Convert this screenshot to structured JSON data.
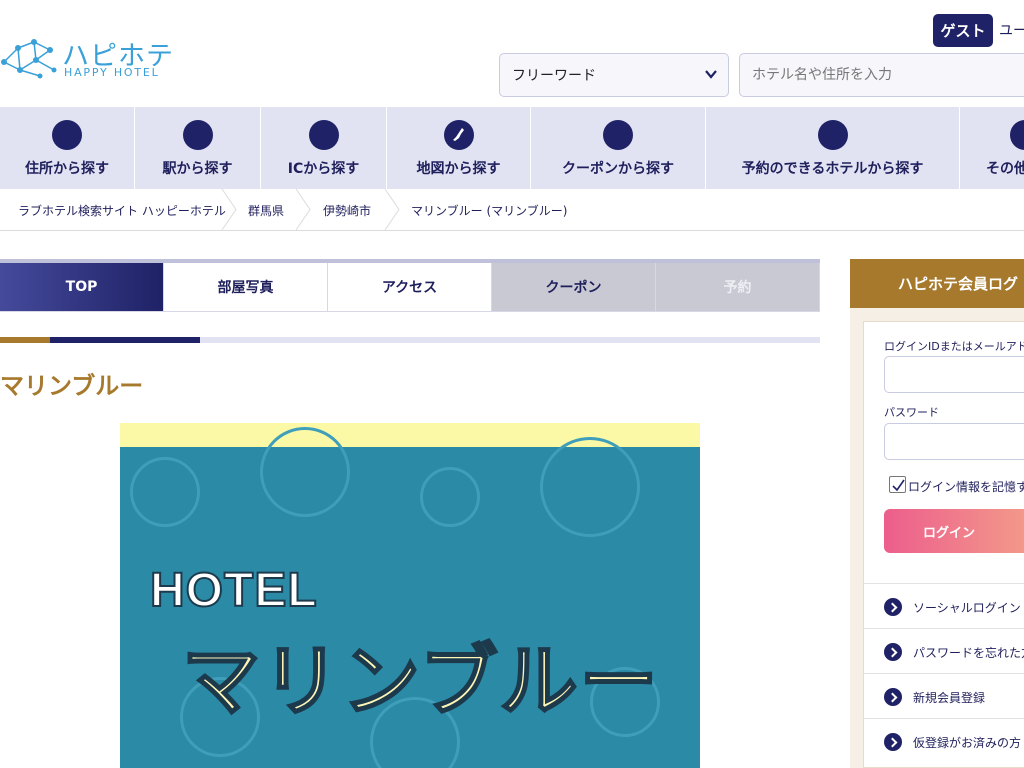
{
  "header": {
    "logo_jp": "ハピホテ",
    "logo_en": "HAPPY HOTEL",
    "guest_badge": "ゲスト",
    "user_text": "ユー",
    "search_mode": "フリーワード",
    "search_placeholder": "ホテル名や住所を入力"
  },
  "nav": {
    "items": [
      {
        "label": "住所から探す"
      },
      {
        "label": "駅から探す"
      },
      {
        "label": "ICから探す"
      },
      {
        "label": "地図から探す"
      },
      {
        "label": "クーポンから探す"
      },
      {
        "label": "予約のできるホテルから探す"
      },
      {
        "label": "その他"
      }
    ]
  },
  "breadcrumb": {
    "items": [
      "ラブホテル検索サイト ハッピーホテル",
      "群馬県",
      "伊勢崎市",
      "マリンブルー (マリンブルー)"
    ]
  },
  "tabs": {
    "items": [
      "TOP",
      "部屋写真",
      "アクセス",
      "クーポン",
      "予約"
    ]
  },
  "hotel": {
    "name": "マリンブルー",
    "image_text_line1": "HOTEL",
    "image_text_line2": "マリンブルー"
  },
  "login": {
    "title": "ハピホテ会員ログ",
    "id_label": "ログインIDまたはメールアドレ",
    "password_label": "パスワード",
    "remember_label": "ログイン情報を記憶す",
    "login_button": "ログイン",
    "links": [
      "ソーシャルログイン",
      "パスワードを忘れた方",
      "新規会員登録",
      "仮登録がお済みの方"
    ]
  },
  "colors": {
    "navy": "#1f2266",
    "gold": "#a7792c",
    "nav_bg": "#e1e2f2",
    "logo_blue": "#3aa0d8",
    "login_gradient_start": "#ec5e8c",
    "login_gradient_end": "#f4a08a"
  }
}
